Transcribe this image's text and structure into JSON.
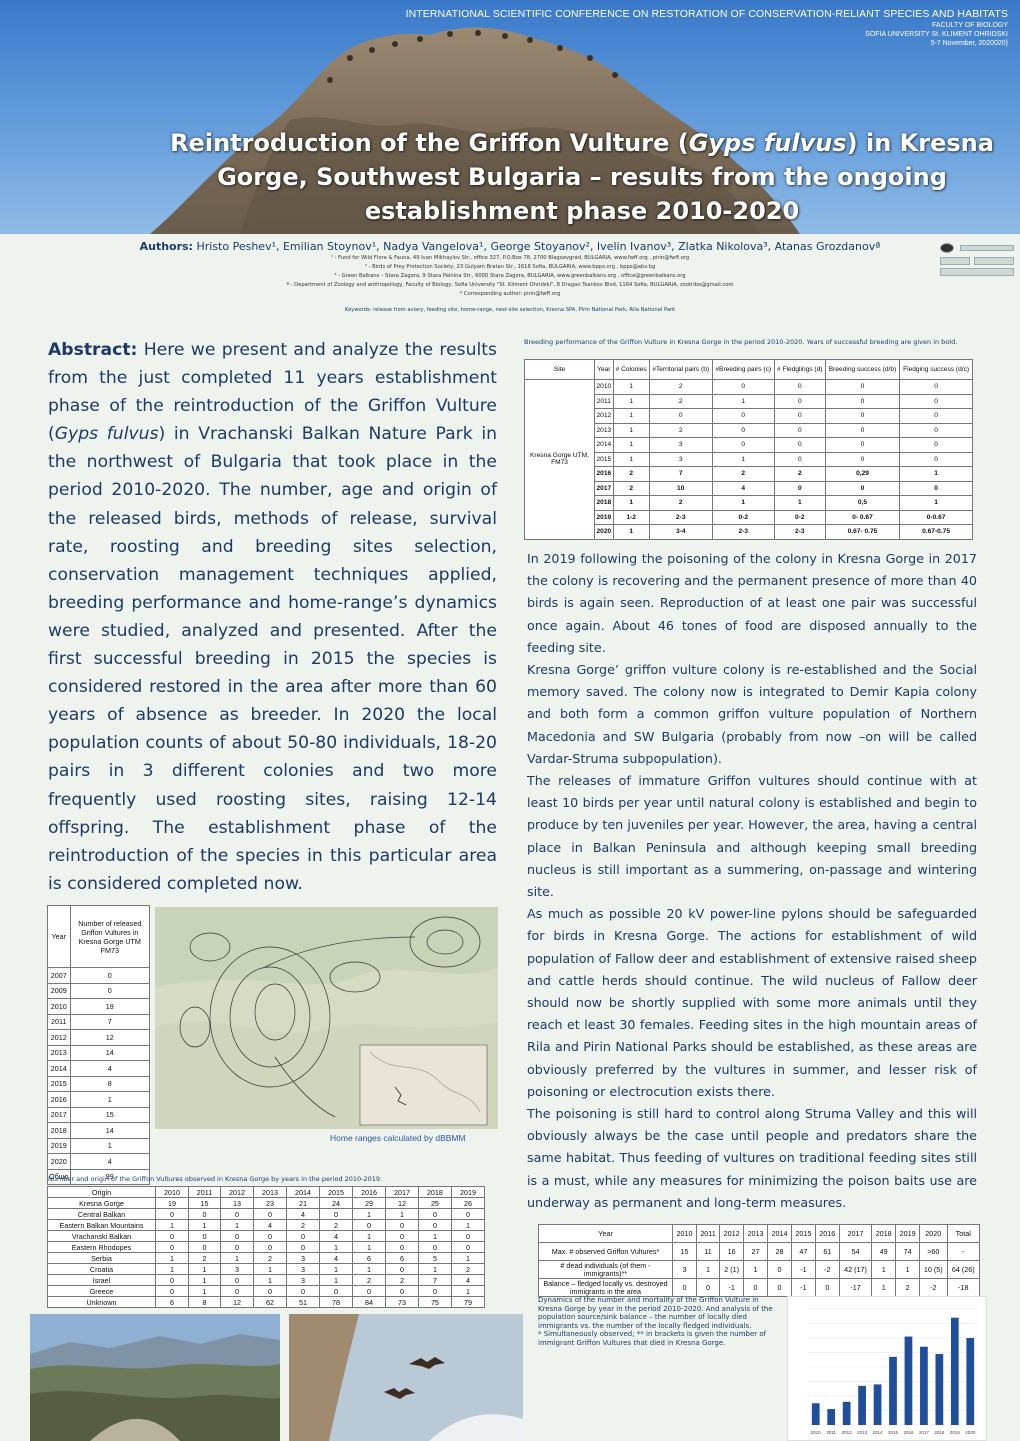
{
  "conference": {
    "title": "INTERNATIONAL SCIENTIFIC CONFERENCE ON RESTORATION OF CONSERVATION-RELIANT SPECIES AND HABITATS",
    "faculty": "FACULTY OF BIOLOGY",
    "university": "SOFIA UNIVERSITY St. KLIMENT OHRIDSKI",
    "dates": "5-7 November, 2020020)"
  },
  "title": {
    "line1_pre": "Reintroduction of the Griffon Vulture (",
    "line1_italic": "Gyps fulvus",
    "line1_post": ") in Kresna",
    "line2": "Gorge, Southwest Bulgaria – results from the ongoing",
    "line3": "establishment phase 2010-2020"
  },
  "authors": {
    "label": "Authors:",
    "names": "Hristo Peshev¹, Emilian Stoynov¹, Nadya Vangelova¹, George Stoyanov², Ivelin Ivanov³, Zlatka Nikolova³, Atanas Grozdanovª",
    "affiliations": [
      "¹ - Fund for Wild Flora & Fauna, 49 Ivan Mikhaylov Str., office 327, P.O.Box 78, 2700 Blagoevgrad, BULGARIA, www.fwff.org , pirin@fwff.org",
      "² - Birds of Prey Protection Society, 23 Gulyam Bratan Str., 1618 Sofia, BULGARIA, www.bpps.org , bpps@abv.bg",
      "³ - Green Balkans – Stara Zagora, 9 Stara Palnina Str., 6000 Stara Zagora, BULGARIA, www.greenbalkans.org , office@greenbalkans.org",
      "ª - Department of Zoology and anthropology, Faculty of Biology, Sofia University \"St. Kliment Ohridski\", 8 Dragan Tsankov Blvd, 1164 Sofia, BULGARIA, zootribo@gmail.com",
      "* Corresponding author: pirin@fwff.org"
    ]
  },
  "keywords": "Keywords: release from aviary, feeding site, home-range, nest-site selection, Kresna SPA, Pirin National Park, Rila National Park",
  "abstract": {
    "label": "Abstract:",
    "text_pre": " Here we present and analyze the results from the just completed 11 years establishment phase of the reintroduction of the Griffon Vulture (",
    "text_italic": "Gyps fulvus",
    "text_post": ") in Vrachanski Balkan Nature Park in the northwest of Bulgaria that took place in the period 2010-2020. The number, age and origin of the released birds, methods of release, survival rate, roosting and breeding sites selection, conservation management techniques applied, breeding performance and home-range’s dynamics were studied, analyzed and presented. After the first successful breeding in 2015 the species is considered restored in the area after more than 60 years of absence as breeder. In 2020 the local population counts of about 50-80 individuals, 18-20 pairs in 3 different colonies and two more frequently used roosting sites, raising 12-14 offspring. The establishment phase of the reintroduction of the species in this particular area is considered completed now."
  },
  "released_table": {
    "header_year": "Year",
    "header_count": "Number of released Griffon Vultures in Kresna Gorge UTM FM73",
    "rows": [
      [
        "2007",
        "0"
      ],
      [
        "2009",
        "0"
      ],
      [
        "2010",
        "19"
      ],
      [
        "2011",
        "7"
      ],
      [
        "2012",
        "12"
      ],
      [
        "2013",
        "14"
      ],
      [
        "2014",
        "4"
      ],
      [
        "2015",
        "8"
      ],
      [
        "2016",
        "1"
      ],
      [
        "2017",
        "15"
      ],
      [
        "2018",
        "14"
      ],
      [
        "2019",
        "1"
      ],
      [
        "2020",
        "4"
      ],
      [
        "Общо",
        "99"
      ]
    ]
  },
  "map_caption": "Home ranges calculated by dBBMM",
  "origin_table": {
    "caption": "Number and origin of the Griffon Vultures observed in Kresna Gorge by years in the period 2010-2019.",
    "header": [
      "Origin",
      "2010",
      "2011",
      "2012",
      "2013",
      "2014",
      "2015",
      "2016",
      "2017",
      "2018",
      "2019"
    ],
    "rows": [
      [
        "Kresna Gorge",
        "19",
        "15",
        "13",
        "23",
        "21",
        "24",
        "29",
        "12",
        "25",
        "26"
      ],
      [
        "Central Balkan",
        "0",
        "0",
        "0",
        "0",
        "4",
        "0",
        "1",
        "1",
        "0",
        "0"
      ],
      [
        "Eastern Balkan Mountains",
        "1",
        "1",
        "1",
        "4",
        "2",
        "2",
        "0",
        "0",
        "0",
        "1"
      ],
      [
        "Vrachanski Balkan",
        "0",
        "0",
        "0",
        "0",
        "0",
        "4",
        "1",
        "0",
        "1",
        "0"
      ],
      [
        "Eastern Rhodopes",
        "0",
        "0",
        "0",
        "0",
        "0",
        "1",
        "1",
        "0",
        "0",
        "0"
      ],
      [
        "Serbia",
        "1",
        "2",
        "1",
        "2",
        "3",
        "4",
        "6",
        "6",
        "5",
        "1"
      ],
      [
        "Croatia",
        "1",
        "1",
        "3",
        "1",
        "3",
        "1",
        "1",
        "0",
        "1",
        "2"
      ],
      [
        "Israel",
        "0",
        "1",
        "0",
        "1",
        "3",
        "1",
        "2",
        "2",
        "7",
        "4"
      ],
      [
        "Greece",
        "0",
        "1",
        "0",
        "0",
        "0",
        "0",
        "0",
        "0",
        "0",
        "1"
      ],
      [
        "Unknown",
        "6",
        "8",
        "12",
        "62",
        "51",
        "78",
        "84",
        "73",
        "75",
        "79"
      ]
    ]
  },
  "breeding_table": {
    "caption": "Breeding performance of the Griffon Vulture in Kresna Gorge in the period 2010-2020. Years of successful breeding are given in bold.",
    "header": [
      "Site",
      "Year",
      "# Colonies",
      "#Territorial pairs (b)",
      "#Breeding pairs (c)",
      "# Fledglings (d)",
      "Breeding success (d/b)",
      "Fledging success (d/c)"
    ],
    "site": "Kresna Gorge UTM, FM73",
    "rows": [
      {
        "v": [
          "2010",
          "1",
          "2",
          "0",
          "0",
          "0",
          "0"
        ],
        "bold": false
      },
      {
        "v": [
          "2011",
          "1",
          "2",
          "1",
          "0",
          "0",
          "0"
        ],
        "bold": false
      },
      {
        "v": [
          "2012",
          "1",
          "0",
          "0",
          "0",
          "0",
          "0"
        ],
        "bold": false
      },
      {
        "v": [
          "2013",
          "1",
          "2",
          "0",
          "0",
          "0",
          "0"
        ],
        "bold": false
      },
      {
        "v": [
          "2014",
          "1",
          "3",
          "0",
          "0",
          "0",
          "0"
        ],
        "bold": false
      },
      {
        "v": [
          "2015",
          "1",
          "3",
          "1",
          "0",
          "0",
          "0"
        ],
        "bold": false
      },
      {
        "v": [
          "2016",
          "2",
          "7",
          "2",
          "2",
          "0,29",
          "1"
        ],
        "bold": true
      },
      {
        "v": [
          "2017",
          "2",
          "10",
          "4",
          "0",
          "0",
          "0"
        ],
        "bold": true
      },
      {
        "v": [
          "2018",
          "1",
          "2",
          "1",
          "1",
          "0,5",
          "1"
        ],
        "bold": true
      },
      {
        "v": [
          "2019",
          "1-2",
          "2-3",
          "0-2",
          "0-2",
          "0- 0.67",
          "0-0.67"
        ],
        "bold": true
      },
      {
        "v": [
          "2020",
          "1",
          "3-4",
          "2-3",
          "2-3",
          "0.67- 0.75",
          "0.67-0.75"
        ],
        "bold": true
      }
    ]
  },
  "right_text": [
    "In 2019 following the poisoning of the colony in Kresna Gorge in 2017 the colony is recovering and the permanent presence of more than 40 birds is again seen. Reproduction of at least one pair was successful once again. About 46 tones of food are disposed annually to the feeding site.",
    "Kresna Gorge’ griffon vulture colony is re-established and the Social memory saved. The colony now is integrated to Demir Kapia colony and both form a common griffon vulture population of Northern Macedonia and SW Bulgaria (probably from now –on will be called Vardar-Struma subpopulation).",
    "The releases of immature Griffon vultures should continue with at least 10 birds per year until natural colony is established and begin to produce by ten juveniles per year. However, the area, having a central place in Balkan Peninsula and although keeping small breeding nucleus is still important as a summering, on-passage and wintering site.",
    "As much as possible 20 kV power-line pylons should be safeguarded for birds in Kresna Gorge. The actions for establishment of wild population of Fallow deer and establishment of extensive raised sheep and cattle herds should continue. The wild nucleus of Fallow deer should now be shortly supplied with some more animals until they reach et least 30 females. Feeding sites in the high mountain areas of Rila and Pirin National Parks should be established, as these areas are obviously preferred by the vultures in summer, and lesser risk of poisoning or electrocution exists there.",
    "The poisoning is still hard to control along Struma Valley and this will obviously always be the case until people and predators share the same habitat. Thus feeding of vultures on traditional feeding sites still is a must, while any measures for minimizing the poison baits use are underway as permanent and long-term measures."
  ],
  "dynamics_table": {
    "header": [
      "Year",
      "2010",
      "2011",
      "2012",
      "2013",
      "2014",
      "2015",
      "2016",
      "2017",
      "2018",
      "2019",
      "2020",
      "Total"
    ],
    "rows": [
      [
        "Max. # observed Griffon Vultures*",
        "15",
        "11",
        "16",
        "27",
        "28",
        "47",
        "61",
        "54",
        "49",
        "74",
        ">60",
        "-"
      ],
      [
        "# dead individuals (of them - immigrants)**",
        "3",
        "1",
        "2 (1)",
        "1",
        "0",
        "-1",
        "-2",
        "42 (17)",
        "1",
        "1",
        "10 (5)",
        "64 (26)"
      ],
      [
        "Balance – fledged locally vs. destroyed immigrants in the area",
        "0",
        "0",
        "-1",
        "0",
        "0",
        "-1",
        "0",
        "-17",
        "1",
        "2",
        "-2",
        "-18"
      ]
    ]
  },
  "dynamics_caption": {
    "main": "Dynamics of the number and mortality of the Griffon Vulture in Kresna Gorge by year in the period 2010-2020. And analysis of the population source/sink balance – the number of locally died immigrants vs. the number of the locally fledged individuals.",
    "note": "* Simultaneously observed; ** in brackets is given the number of immigrant Griffon Vultures that died in Kresna Gorge."
  },
  "bar_chart": {
    "categories": [
      "2010",
      "2011",
      "2012",
      "2013",
      "2014",
      "2015",
      "2016",
      "2017",
      "2018",
      "2019",
      "2020"
    ],
    "values": [
      15,
      11,
      16,
      27,
      28,
      47,
      61,
      54,
      49,
      74,
      60
    ],
    "color": "#1f4e9a"
  }
}
